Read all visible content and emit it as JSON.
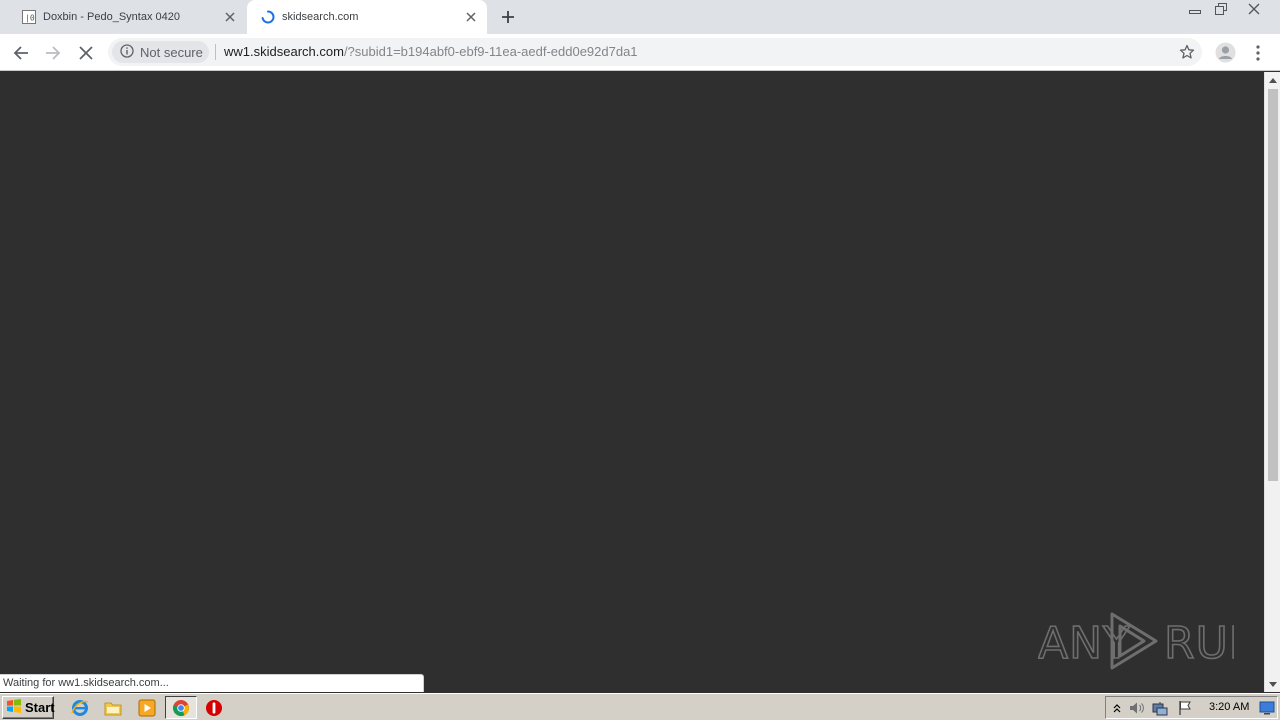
{
  "tabs": [
    {
      "title": "Doxbin - Pedo_Syntax 0420",
      "active": false,
      "favicon": "doxbin-favicon-icon"
    },
    {
      "title": "skidsearch.com",
      "active": true,
      "favicon": "loading-spinner-icon"
    }
  ],
  "address_bar": {
    "security_label": "Not secure",
    "url_host": "ww1.skidsearch.com",
    "url_rest": "/?subid1=b194abf0-ebf9-11ea-aedf-edd0e92d7da1"
  },
  "status_bubble": "Waiting for ww1.skidsearch.com...",
  "watermark": {
    "text_left": "ANY",
    "text_right": "RUN"
  },
  "taskbar": {
    "start_label": "Start",
    "clock": "3:20 AM",
    "quick_launch": [
      "internet-explorer-icon",
      "file-explorer-icon",
      "media-player-icon",
      "chrome-icon",
      "stop-sign-icon"
    ]
  },
  "colors": {
    "page_background": "#2f2f2f",
    "tabstrip": "#dee1e6",
    "omnibox": "#f1f3f4",
    "taskbar": "#d4d0c8",
    "spinner": "#1a73e8"
  }
}
